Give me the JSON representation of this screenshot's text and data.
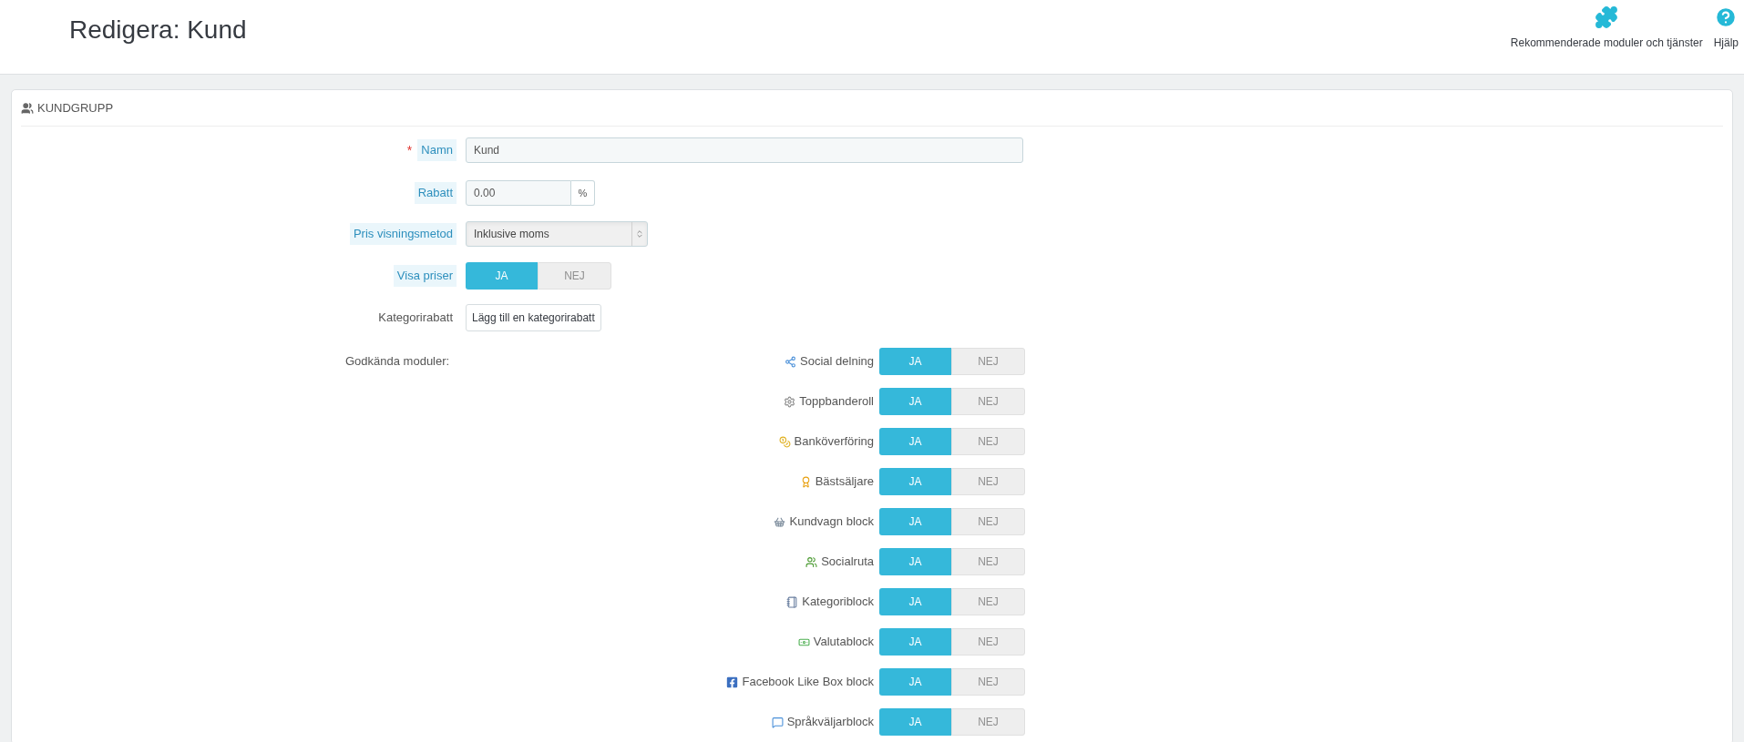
{
  "header": {
    "title": "Redigera: Kund",
    "toolbar": [
      {
        "label": "Rekommenderade moduler och tjänster"
      },
      {
        "label": "Hjälp"
      }
    ]
  },
  "panel": {
    "title": "KUNDGRUPP",
    "name_field": {
      "label": "Namn",
      "required_mark": "*",
      "has_hint": true,
      "value": "Kund"
    },
    "discount_field": {
      "label": "Rabatt",
      "has_hint": true,
      "value": "0.00",
      "addon": "%"
    },
    "price_display": {
      "label": "Pris visningsmetod",
      "has_hint": true,
      "value": "Inklusive moms"
    },
    "show_prices": {
      "label": "Visa priser",
      "has_hint": true,
      "options": [
        {
          "label": "JA",
          "selected": true
        },
        {
          "label": "NEJ",
          "selected": false
        }
      ]
    },
    "category_discount": {
      "label": "Kategorirabatt",
      "has_hint": false,
      "button": "Lägg till en kategorirabatt"
    },
    "modules_label": "Godkända moduler:",
    "modules": [
      {
        "name": "Social delning",
        "options": [
          {
            "label": "JA",
            "selected": true
          },
          {
            "label": "NEJ",
            "selected": false
          }
        ]
      },
      {
        "name": "Toppbanderoll",
        "options": [
          {
            "label": "JA",
            "selected": true
          },
          {
            "label": "NEJ",
            "selected": false
          }
        ]
      },
      {
        "name": "Banköverföring",
        "options": [
          {
            "label": "JA",
            "selected": true
          },
          {
            "label": "NEJ",
            "selected": false
          }
        ]
      },
      {
        "name": "Bästsäljare",
        "options": [
          {
            "label": "JA",
            "selected": true
          },
          {
            "label": "NEJ",
            "selected": false
          }
        ]
      },
      {
        "name": "Kundvagn block",
        "options": [
          {
            "label": "JA",
            "selected": true
          },
          {
            "label": "NEJ",
            "selected": false
          }
        ]
      },
      {
        "name": "Socialruta",
        "options": [
          {
            "label": "JA",
            "selected": true
          },
          {
            "label": "NEJ",
            "selected": false
          }
        ]
      },
      {
        "name": "Kategoriblock",
        "options": [
          {
            "label": "JA",
            "selected": true
          },
          {
            "label": "NEJ",
            "selected": false
          }
        ]
      },
      {
        "name": "Valutablock",
        "options": [
          {
            "label": "JA",
            "selected": true
          },
          {
            "label": "NEJ",
            "selected": false
          }
        ]
      },
      {
        "name": "Facebook Like Box block",
        "options": [
          {
            "label": "JA",
            "selected": true
          },
          {
            "label": "NEJ",
            "selected": false
          }
        ]
      },
      {
        "name": "Språkväljarblock",
        "options": [
          {
            "label": "JA",
            "selected": true
          },
          {
            "label": "NEJ",
            "selected": false
          }
        ]
      }
    ]
  }
}
